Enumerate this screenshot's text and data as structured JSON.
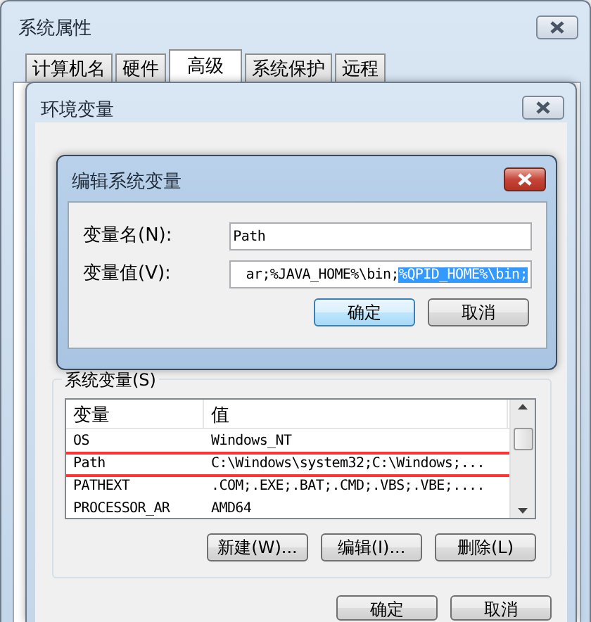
{
  "window": {
    "title": "系统属性",
    "tabs": [
      {
        "label": "计算机名",
        "selected": false
      },
      {
        "label": "硬件",
        "selected": false
      },
      {
        "label": "高级",
        "selected": true
      },
      {
        "label": "系统保护",
        "selected": false
      },
      {
        "label": "远程",
        "selected": false
      }
    ]
  },
  "env_dialog": {
    "title": "环境变量",
    "system_vars": {
      "title": "系统变量(S)",
      "columns": [
        "变量",
        "值"
      ],
      "rows": [
        {
          "name": "OS",
          "value": "Windows_NT",
          "highlighted": false
        },
        {
          "name": "Path",
          "value": "C:\\Windows\\system32;C:\\Windows;...",
          "highlighted": true
        },
        {
          "name": "PATHEXT",
          "value": ".COM;.EXE;.BAT;.CMD;.VBS;.VBE;....",
          "highlighted": false
        },
        {
          "name": "PROCESSOR_AR",
          "value": "AMD64",
          "highlighted": false
        }
      ],
      "buttons": [
        "新建(W)...",
        "编辑(I)...",
        "删除(L)"
      ]
    },
    "buttons": [
      "确定",
      "取消"
    ]
  },
  "edit_dialog": {
    "title": "编辑系统变量",
    "fields": [
      {
        "label": "变量名(N):",
        "value": "Path"
      },
      {
        "label": "变量值(V):",
        "value": "ar;%JAVA_HOME%\\bin;",
        "selected_text": "%QPID_HOME%\\bin;"
      }
    ],
    "buttons": [
      {
        "label": "确定",
        "default": true
      },
      {
        "label": "取消",
        "default": false
      }
    ]
  }
}
